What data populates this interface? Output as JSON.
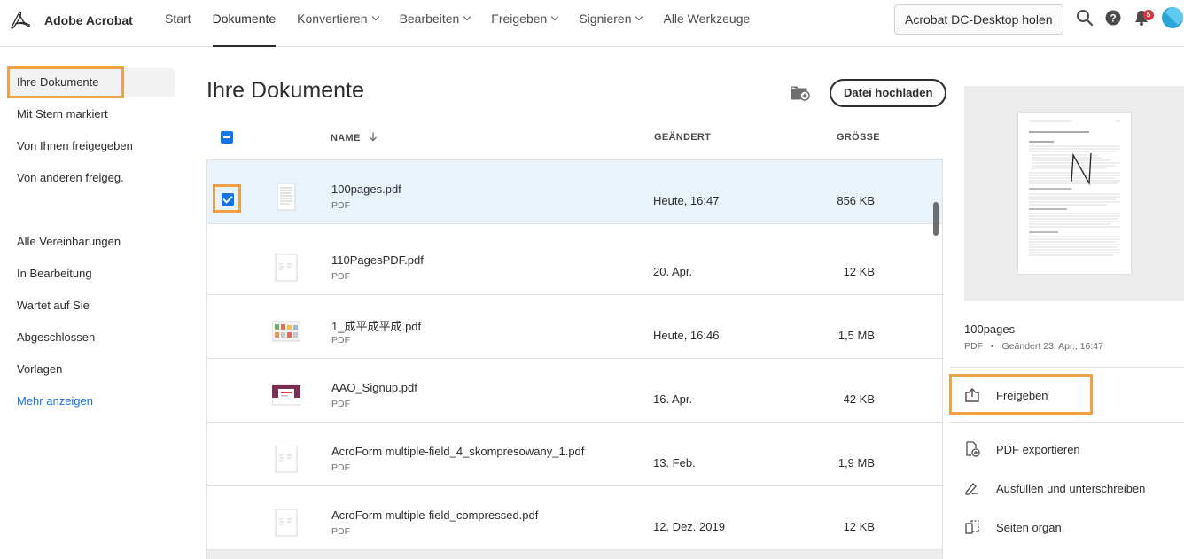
{
  "app": {
    "name": "Adobe Acrobat"
  },
  "nav": [
    {
      "label": "Start",
      "dropdown": false,
      "active": false
    },
    {
      "label": "Dokumente",
      "dropdown": false,
      "active": true
    },
    {
      "label": "Konvertieren",
      "dropdown": true,
      "active": false
    },
    {
      "label": "Bearbeiten",
      "dropdown": true,
      "active": false
    },
    {
      "label": "Freigeben",
      "dropdown": true,
      "active": false
    },
    {
      "label": "Signieren",
      "dropdown": true,
      "active": false
    },
    {
      "label": "Alle Werkzeuge",
      "dropdown": false,
      "active": false
    }
  ],
  "toolbar": {
    "desktop_button": "Acrobat DC-Desktop holen",
    "notification_count": "5"
  },
  "sidebar": {
    "items": [
      {
        "label": "Ihre Dokumente"
      },
      {
        "label": "Mit Stern markiert"
      },
      {
        "label": "Von Ihnen freigegeben"
      },
      {
        "label": "Von anderen freigeg."
      },
      {
        "label": "Alle Vereinbarungen"
      },
      {
        "label": "In Bearbeitung"
      },
      {
        "label": "Wartet auf Sie"
      },
      {
        "label": "Abgeschlossen"
      },
      {
        "label": "Vorlagen"
      },
      {
        "label": "Mehr anzeigen"
      }
    ]
  },
  "main": {
    "title": "Ihre Dokumente",
    "upload_label": "Datei hochladen",
    "columns": {
      "name": "NAME",
      "modified": "GEÄNDERT",
      "size": "GRÖSSE"
    },
    "files": [
      {
        "name": "100pages.pdf",
        "type": "PDF",
        "modified": "Heute, 16:47",
        "size": "856 KB",
        "selected": true
      },
      {
        "name": "110PagesPDF.pdf",
        "type": "PDF",
        "modified": "20. Apr.",
        "size": "12 KB",
        "selected": false
      },
      {
        "name": "1_成平成平成.pdf",
        "type": "PDF",
        "modified": "Heute, 16:46",
        "size": "1,5 MB",
        "selected": false
      },
      {
        "name": "AAO_Signup.pdf",
        "type": "PDF",
        "modified": "16. Apr.",
        "size": "42 KB",
        "selected": false
      },
      {
        "name": "AcroForm multiple-field_4_skompresowany_1.pdf",
        "type": "PDF",
        "modified": "13. Feb.",
        "size": "1,9 MB",
        "selected": false
      },
      {
        "name": "AcroForm multiple-field_compressed.pdf",
        "type": "PDF",
        "modified": "12. Dez. 2019",
        "size": "12 KB",
        "selected": false
      }
    ]
  },
  "preview": {
    "name": "100pages",
    "type": "PDF",
    "modified_label": "Geändert",
    "modified": "23. Apr., 16:47",
    "actions": [
      {
        "label": "Freigeben",
        "icon": "share-icon"
      },
      {
        "label": "PDF exportieren",
        "icon": "export-pdf-icon"
      },
      {
        "label": "Ausfüllen und unterschreiben",
        "icon": "fill-sign-icon"
      },
      {
        "label": "Seiten organ.",
        "icon": "organize-pages-icon"
      }
    ]
  },
  "colors": {
    "accent": "#1473e6",
    "highlight": "#f0a046",
    "selected_row": "#e9f3fc"
  }
}
